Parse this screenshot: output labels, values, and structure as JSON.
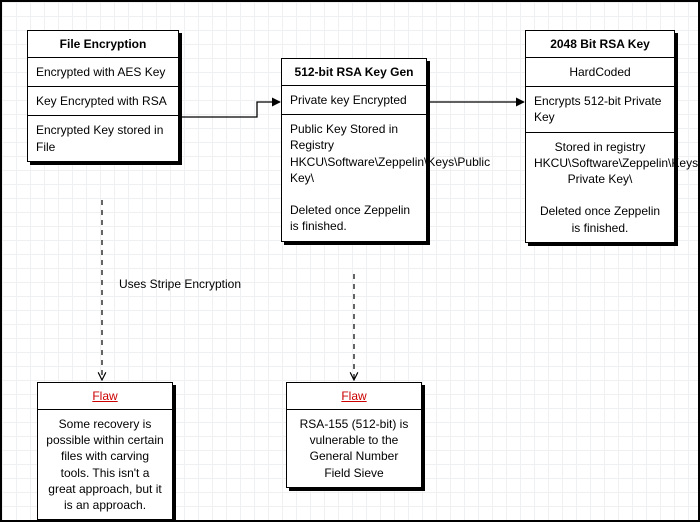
{
  "boxes": {
    "fileEncryption": {
      "title": "File Encryption",
      "cells": [
        "Encrypted with AES Key",
        "Key Encrypted with RSA",
        "Encrypted Key stored in File"
      ]
    },
    "rsa512": {
      "title": "512-bit RSA Key Gen",
      "cells": [
        "Private key Encrypted",
        "Public Key Stored in Registry HKCU\\Software\\Zeppelin\\Keys\\Public Key\\\n\nDeleted once Zeppelin is finished."
      ]
    },
    "rsa2048": {
      "title": "2048 Bit RSA Key",
      "cells": [
        "HardCoded",
        "Encrypts 512-bit Private Key",
        "Stored in registry HKCU\\Software\\Zeppelin\\Keys\\Encrypted Private Key\\\n\nDeleted once Zeppelin is finished."
      ]
    },
    "flawLeft": {
      "title": "Flaw",
      "body": "Some recovery is possible within certain files with carving tools. This isn't a great approach, but it is an approach."
    },
    "flawRight": {
      "title": "Flaw",
      "body": "RSA-155 (512-bit) is vulnerable to the General Number Field Sieve"
    }
  },
  "edgeLabels": {
    "stripe": "Uses Stripe Encryption"
  }
}
